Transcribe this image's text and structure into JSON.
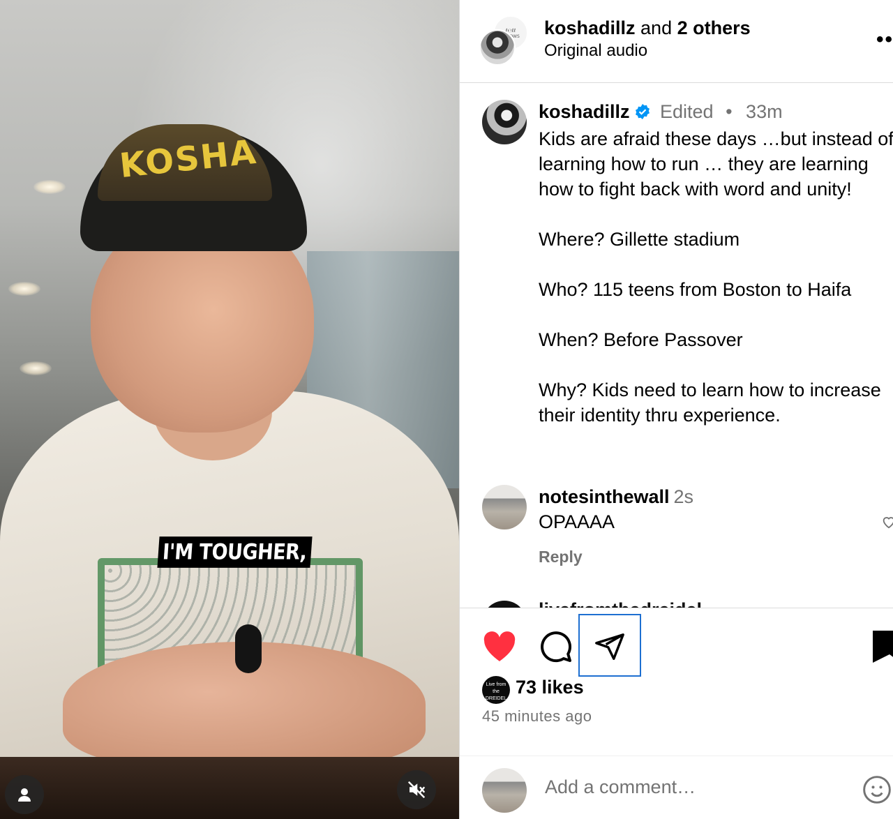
{
  "video": {
    "caption_overlay": "I'M TOUGHER,",
    "cap_text": "KOSHA",
    "user_tag_icon": "person-icon",
    "mute_icon": "speaker-muted-icon"
  },
  "header": {
    "username": "koshadillz",
    "and_text": " and ",
    "others": "2 others",
    "subtitle": "Original audio",
    "more_label": "••"
  },
  "post": {
    "username": "koshadillz",
    "edited": "Edited",
    "separator": "•",
    "time": "33m",
    "caption": "Kids are afraid these days …but instead of learning how to run … they are learning how to fight back with word and unity!\n\nWhere? Gillette stadium\n\nWho? 115 teens from Boston to Haifa\n\nWhen? Before Passover\n\nWhy? Kids need to learn how to increase their identity thru experience."
  },
  "comments": [
    {
      "username": "notesinthewall",
      "time": "2s",
      "text": "OPAAAA",
      "reply_label": "Reply"
    }
  ],
  "next_comment_partial": "livefromthedreidel",
  "actions": {
    "liked": true,
    "like_color": "#ff3040",
    "share_highlight_color": "#1d6fd1",
    "likes_avatar_text": "Live from the DREIDEL",
    "likes": "73 likes",
    "time_ago": "45 minutes ago"
  },
  "add_comment": {
    "placeholder": "Add a comment…"
  }
}
